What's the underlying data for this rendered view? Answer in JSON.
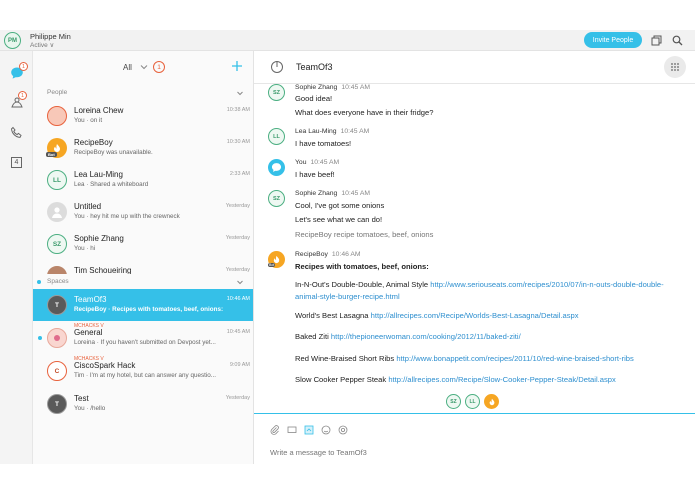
{
  "topbar": {
    "user_initials": "PM",
    "user_name": "Philippe Min",
    "user_status": "Active ∨",
    "invite_label": "Invite People"
  },
  "rail": {
    "messages_badge": "1",
    "teams_badge": "1",
    "calendar_day": "4"
  },
  "list": {
    "filter_label": "All",
    "filter_badge": "1",
    "people_header": "People",
    "spaces_header": "Spaces",
    "people": [
      {
        "title": "Loreina Chew",
        "sub": "You · on it",
        "time": "10:38 AM"
      },
      {
        "title": "RecipeBoy",
        "sub": "RecipeBoy was unavailable.",
        "time": "10:30 AM",
        "badge": "Bot"
      },
      {
        "title": "Lea Lau-Ming",
        "sub": "Lea · Shared a whiteboard",
        "time": "2:33 AM",
        "initials": "LL"
      },
      {
        "title": "Untitled",
        "sub": "You · hey hit me up with the crewneck",
        "time": "Yesterday"
      },
      {
        "title": "Sophie Zhang",
        "sub": "You · hi",
        "time": "Yesterday",
        "initials": "SZ"
      },
      {
        "title": "Tim Schoueiring",
        "sub": "",
        "time": "Yesterday"
      }
    ],
    "spaces": [
      {
        "title": "TeamOf3",
        "sub": "RecipeBoy · Recipes with tomatoes, beef, onions:",
        "time": "10:46 AM",
        "initials": "T"
      },
      {
        "group": "MCHACKS V",
        "title": "General",
        "sub": "Loreina · If you haven't submitted on Devpost yet...",
        "time": "10:45 AM"
      },
      {
        "group": "MCHACKS V",
        "title": "CiscoSpark Hack",
        "sub": "Tim · I'm at my hotel, but can answer any questio...",
        "time": "9:09 AM",
        "initials": "C"
      },
      {
        "title": "Test",
        "sub": "You · /hello",
        "time": "Yesterday",
        "initials": "T"
      }
    ]
  },
  "chat": {
    "title": "TeamOf3",
    "messages": [
      {
        "initials": "SZ",
        "name": "Sophie Zhang",
        "time": "10:45 AM",
        "lines": [
          "Good idea!",
          "What does everyone have in their fridge?"
        ]
      },
      {
        "initials": "LL",
        "name": "Lea Lau-Ming",
        "time": "10:45 AM",
        "lines": [
          "I have tomatoes!"
        ]
      },
      {
        "name": "You",
        "time": "10:45 AM",
        "lines": [
          "I have beef!"
        ]
      },
      {
        "initials": "SZ",
        "name": "Sophie Zhang",
        "time": "10:45 AM",
        "lines": [
          "Cool, I've got some onions",
          "Let's see what we can do!",
          "RecipeBoy recipe tomatoes, beef, onions"
        ]
      },
      {
        "name": "RecipeBoy",
        "time": "10:46 AM",
        "badge": "Bot",
        "heading": "Recipes with tomatoes, beef, onions:",
        "recipes": [
          {
            "name": "In-N-Out's Double-Double, Animal Style",
            "url": "http://www.seriouseats.com/recipes/2010/07/in-n-outs-double-double-animal-style-burger-recipe.html"
          },
          {
            "name": "World's Best Lasagna",
            "url": "http://allrecipes.com/Recipe/Worlds-Best-Lasagna/Detail.aspx"
          },
          {
            "name": "Baked Ziti",
            "url": "http://thepioneerwoman.com/cooking/2012/11/baked-ziti/"
          },
          {
            "name": "Red Wine-Braised Short Ribs",
            "url": "http://www.bonappetit.com/recipes/2011/10/red-wine-braised-short-ribs"
          },
          {
            "name": "Slow Cooker Pepper Steak",
            "url": "http://allrecipes.com/Recipe/Slow-Cooker-Pepper-Steak/Detail.aspx"
          }
        ]
      }
    ],
    "read_receipts": [
      "SZ",
      "LL"
    ],
    "composer_placeholder": "Write a message to TeamOf3"
  },
  "colors": {
    "accent": "#35c0e8",
    "badge": "#e8623d",
    "avatar_ring": "#4caf82",
    "link": "#2e8fcf"
  }
}
